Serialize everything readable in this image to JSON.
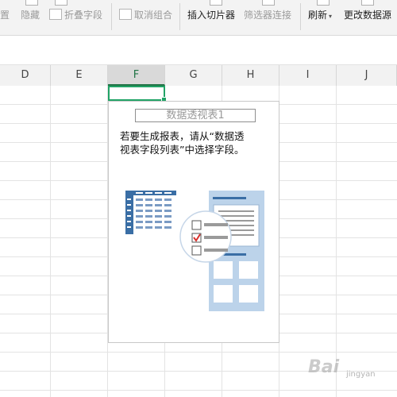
{
  "ribbon": {
    "items": [
      {
        "label": "置",
        "disabled": true
      },
      {
        "label": "隐藏",
        "disabled": true
      },
      {
        "label": "折叠字段",
        "disabled": true
      },
      {
        "label": "取消组合",
        "disabled": true
      },
      {
        "label": "插入切片器",
        "disabled": false
      },
      {
        "label": "筛选器连接",
        "disabled": true
      },
      {
        "label": "刷新",
        "disabled": false
      },
      {
        "label": "更改数据源",
        "disabled": false
      }
    ]
  },
  "columns": [
    "D",
    "E",
    "F",
    "G",
    "H",
    "I",
    "J"
  ],
  "selected_column": "F",
  "pivot": {
    "title": "数据透视表1",
    "instruction_line1": "若要生成报表，请从“数据透",
    "instruction_line2": "视表字段列表”中选择字段。"
  },
  "colors": {
    "accent_green": "#21a366",
    "illustration_blue": "#3a6ea5",
    "panel_blue": "#bcd3ea",
    "check_red": "#d9302c"
  },
  "watermark": {
    "main": "Bai",
    "sub": "jingyan"
  }
}
